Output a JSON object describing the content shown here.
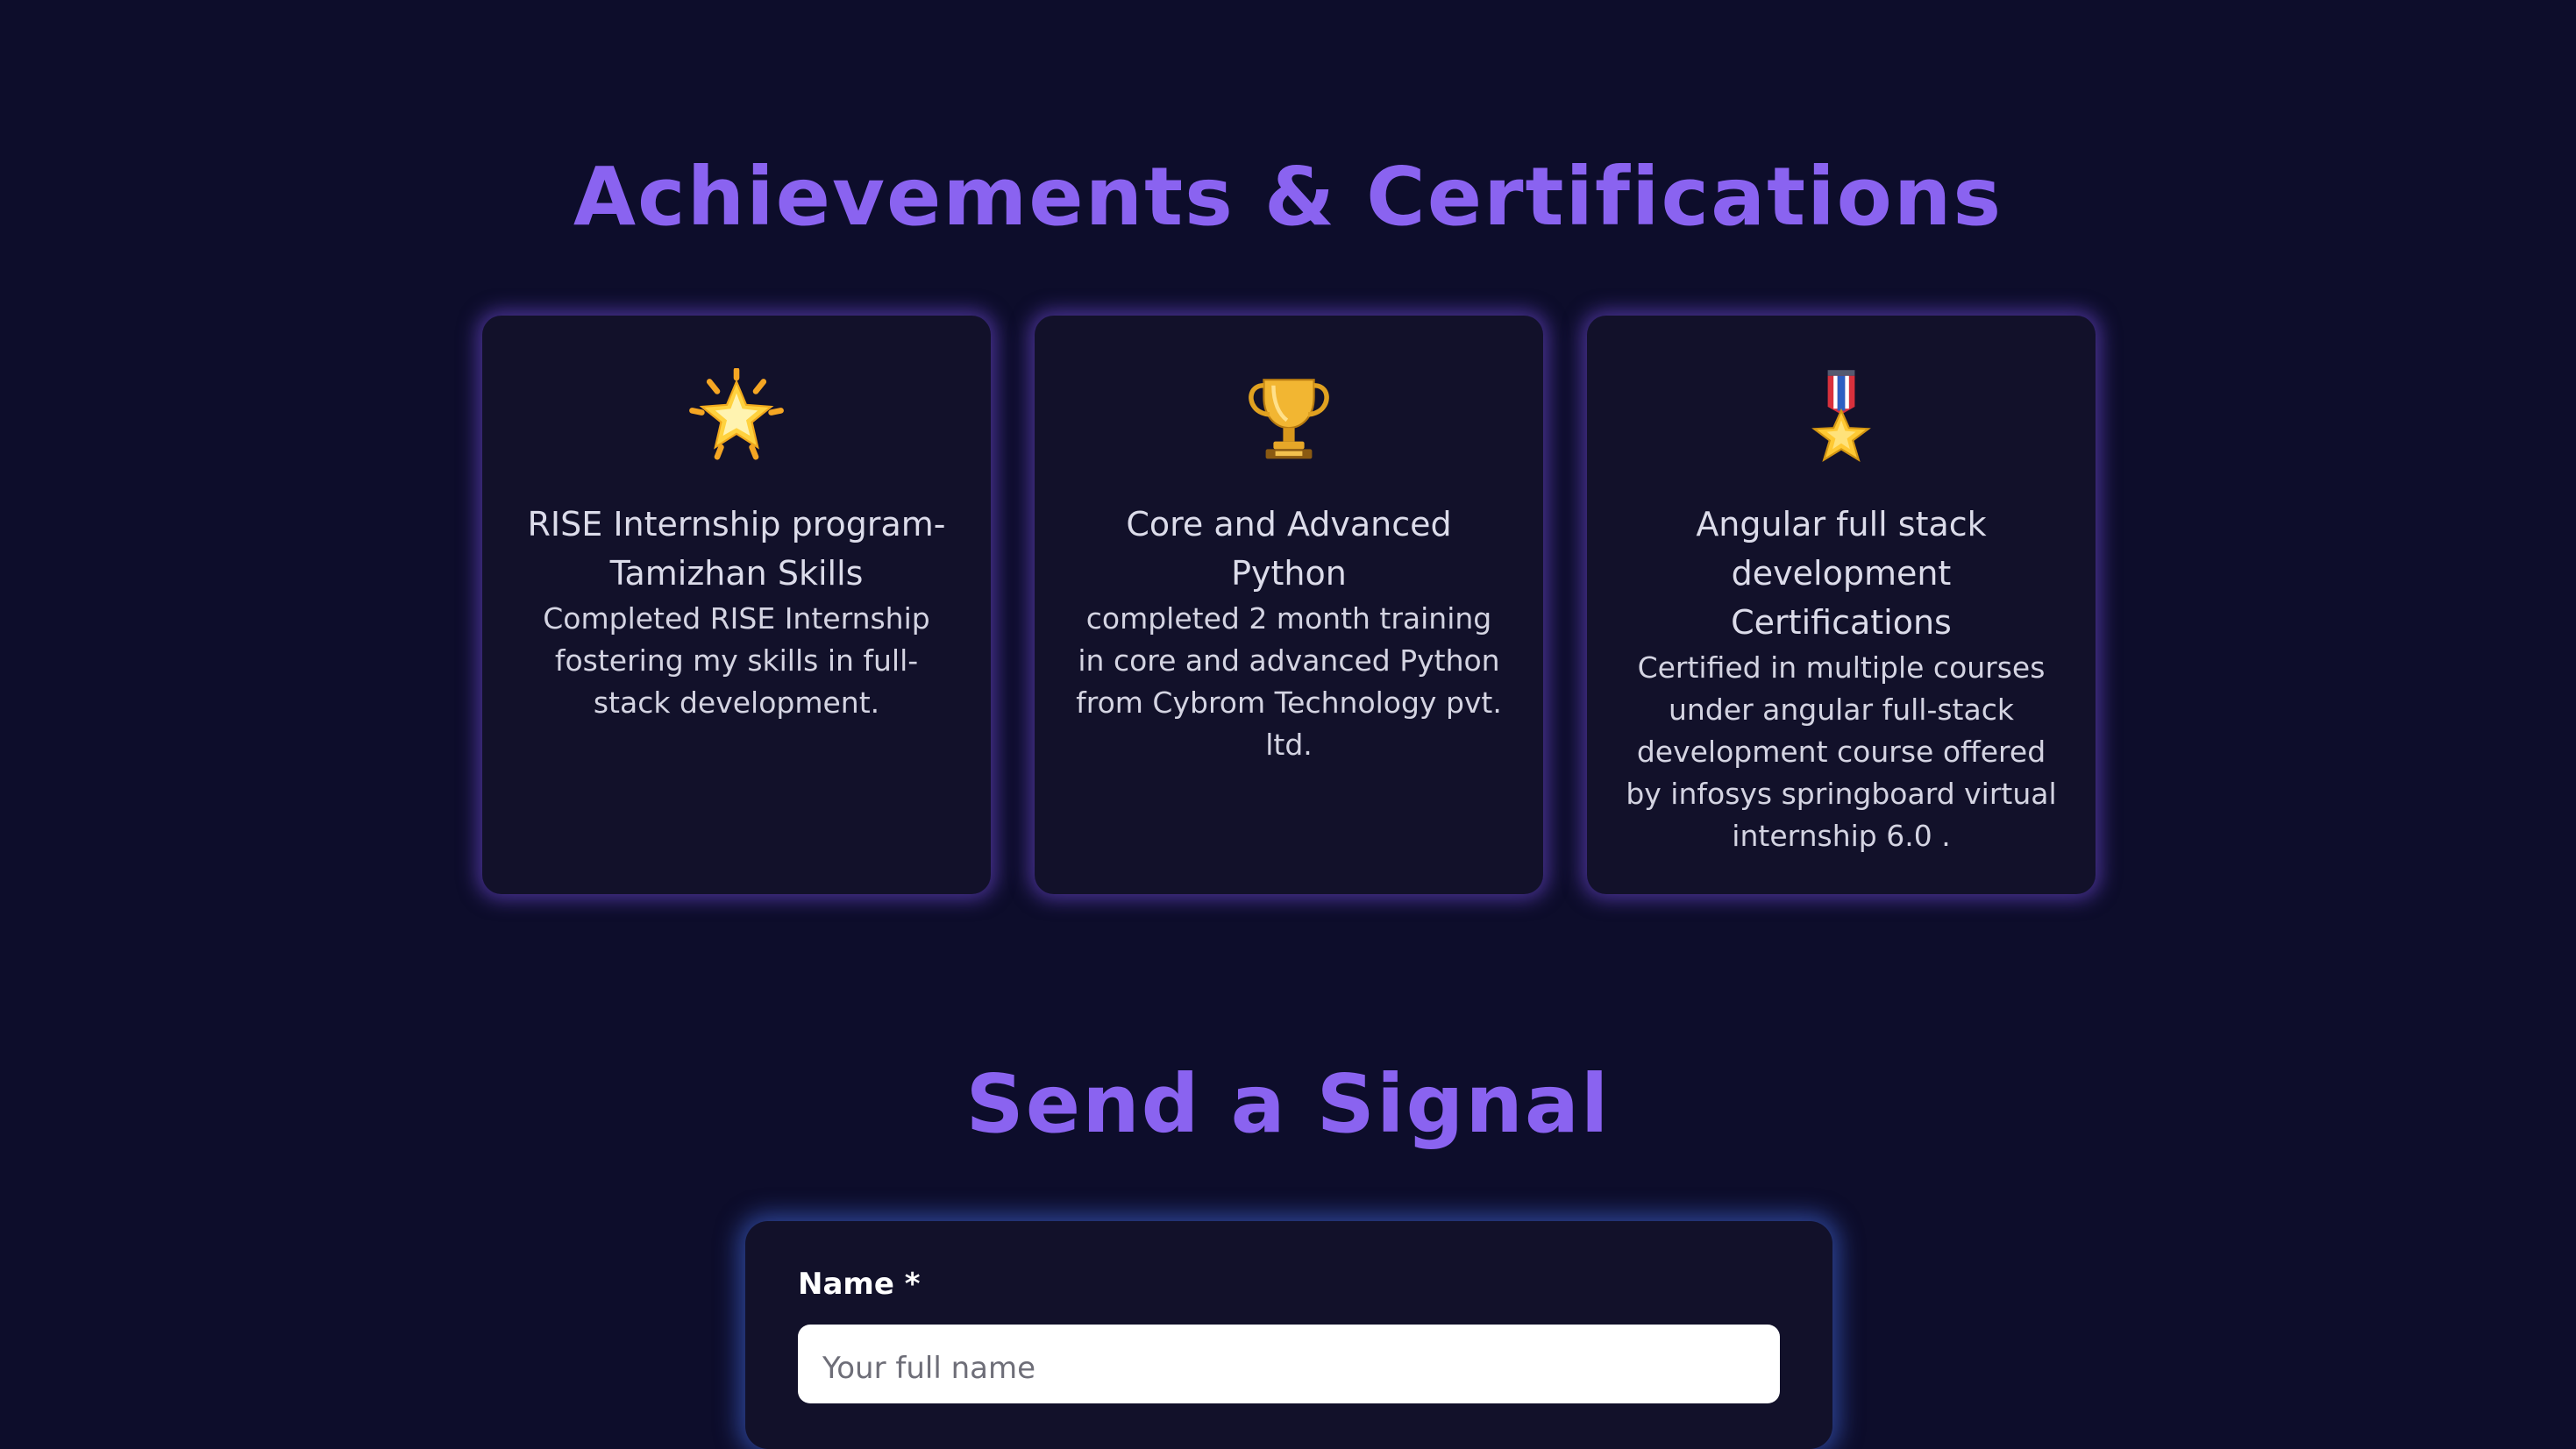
{
  "achievements": {
    "title": "Achievements & Certifications",
    "cards": [
      {
        "icon": "glowing-star-icon",
        "title": "RISE Internship program- Tamizhan Skills",
        "description": "Completed RISE Internship fostering my skills in full-stack development."
      },
      {
        "icon": "trophy-icon",
        "title": "Core and Advanced Python",
        "description": "completed 2 month training in core and advanced Python from Cybrom Technology pvt. ltd."
      },
      {
        "icon": "military-medal-icon",
        "title": "Angular full stack development Certifications",
        "description": "Certified in multiple courses under angular full-stack development course offered by infosys springboard virtual internship 6.0 ."
      }
    ]
  },
  "contact": {
    "title": "Send a Signal",
    "name_label": "Name *",
    "name_placeholder": "Your full name",
    "name_value": ""
  },
  "colors": {
    "background": "#0d0d2b",
    "accent": "#8a63f0",
    "card_bg": "#12112a",
    "card_glow": "#7850e6",
    "form_glow": "#466ee6"
  }
}
